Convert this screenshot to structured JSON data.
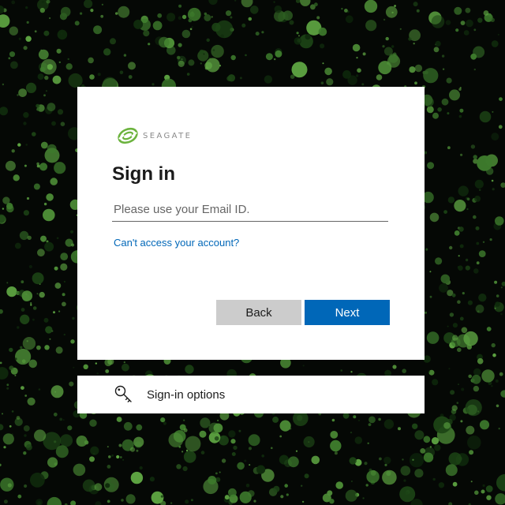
{
  "background": {
    "base_color": "#050805",
    "dot_colors": [
      "#0f2a0c",
      "#1d4516",
      "#2e5f22",
      "#3d7a2c",
      "#4e8f37",
      "#5ea542"
    ]
  },
  "brand": {
    "logo_text": "SEAGATE",
    "logo_color": "#6cb33e"
  },
  "signin": {
    "title": "Sign in",
    "email_placeholder": "Please use your Email ID.",
    "email_value": "",
    "help_link": "Can't access your account?"
  },
  "buttons": {
    "back_label": "Back",
    "next_label": "Next"
  },
  "colors": {
    "accent": "#0067b8",
    "back_button": "#cccccc",
    "card": "#ffffff"
  },
  "signin_options": {
    "label": "Sign-in options",
    "icon": "key-icon"
  }
}
